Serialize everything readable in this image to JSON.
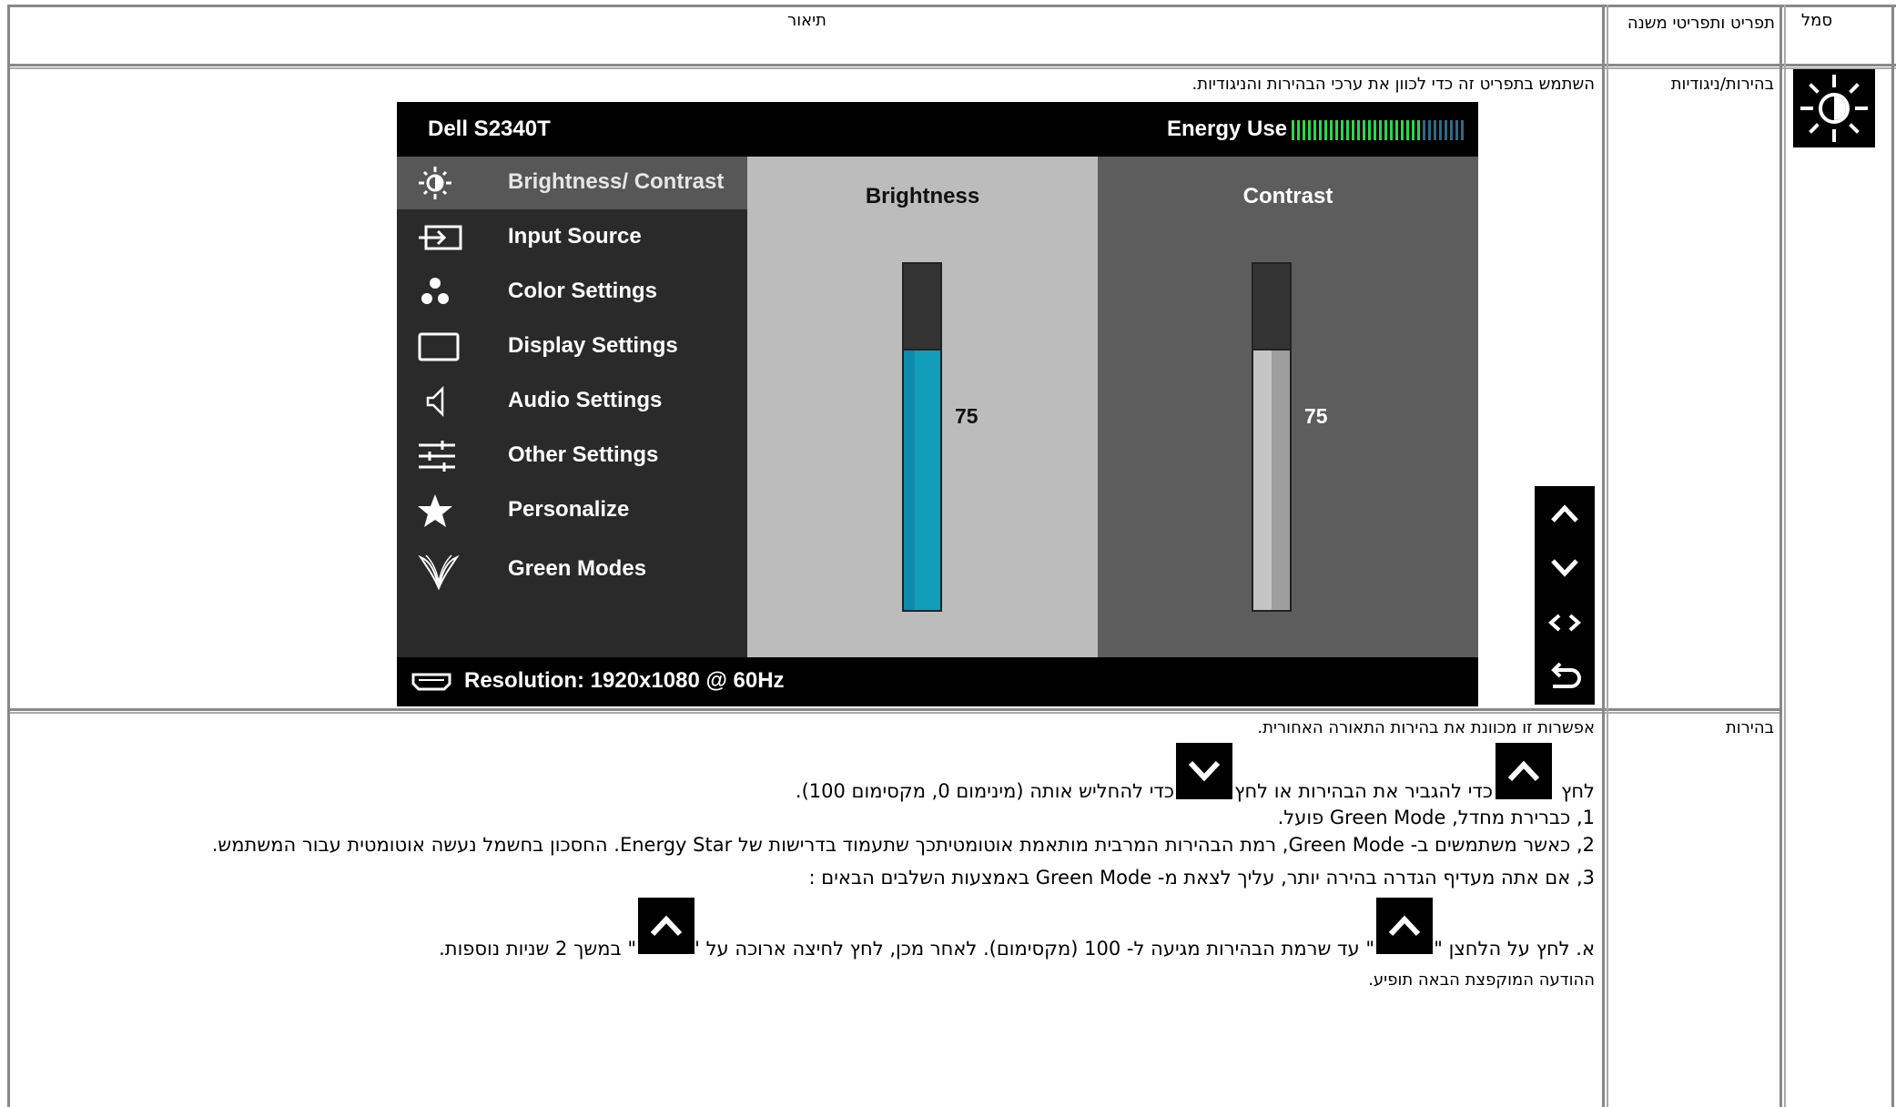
{
  "table": {
    "headers": {
      "icon": "סמל",
      "menu": "תפריט ותפריטי משנה",
      "description": "תיאור"
    },
    "row1": {
      "menu": "בהירות/ניגודיות",
      "description": "השתמש בתפריט זה כדי לכוון את ערכי הבהירות והניגודיות.",
      "icon": "brightness-sun-icon"
    },
    "row2": {
      "menu": "בהירות",
      "line1": "אפשרות זו מכוונת את בהירות התאורה האחורית.",
      "line2_a": "לחץ",
      "line2_b": "כדי להגביר את הבהירות או לחץ",
      "line2_c": "כדי להחליש אותה (מינימום 0, מקסימום 100).",
      "line3": "1, כברירת מחדל, Green Mode פועל.",
      "line4": "2, כאשר משתמשים ב- Green Mode, רמת הבהירות המרבית מותאמת אוטומטיתכך שתעמוד בדרישות של Energy Star. החסכון בחשמל נעשה אוטומטית עבור המשתמש.",
      "line5": "3, אם אתה מעדיף הגדרה בהירה יותר, עליך לצאת מ- Green Mode באמצעות השלבים הבאים :",
      "line6_a": "א. לחץ על הלחצן \"",
      "line6_b": "\" עד שרמת הבהירות מגיעה ל- 100 (מקסימום). לאחר מכן, לחץ לחיצה ארוכה על \"",
      "line6_c": "\" במשך 2 שניות נוספות.",
      "line7": "ההודעה המוקפצת הבאה תופיע."
    }
  },
  "osd": {
    "model": "Dell S2340T",
    "energy_label": "Energy Use",
    "energy_level": 0.75,
    "menu_items": [
      {
        "label": "Brightness/ Contrast",
        "icon": "brightness-icon"
      },
      {
        "label": "Input Source",
        "icon": "input-source-icon"
      },
      {
        "label": "Color Settings",
        "icon": "color-settings-icon"
      },
      {
        "label": "Display Settings",
        "icon": "display-settings-icon"
      },
      {
        "label": "Audio Settings",
        "icon": "audio-icon"
      },
      {
        "label": "Other Settings",
        "icon": "other-settings-icon"
      },
      {
        "label": "Personalize",
        "icon": "star-icon"
      },
      {
        "label": "Green Modes",
        "icon": "green-modes-icon"
      }
    ],
    "brightness": {
      "title": "Brightness",
      "value": "75",
      "level": 0.75
    },
    "contrast": {
      "title": "Contrast",
      "value": "75",
      "level": 0.75
    },
    "resolution": "Resolution: 1920x1080 @ 60Hz",
    "colors": {
      "brightness_fill": "#129dbb",
      "contrast_fill": "#b4b4b4",
      "energy_on": "#2bd64a",
      "energy_off": "#2d6a86"
    }
  }
}
